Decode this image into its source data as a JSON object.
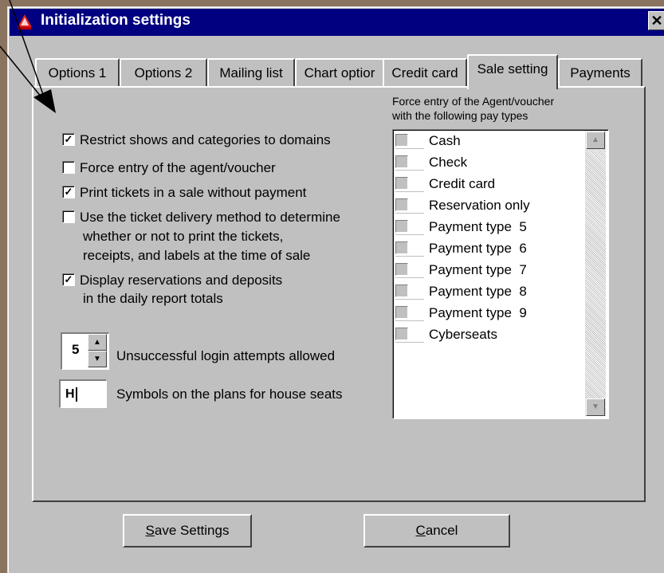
{
  "window": {
    "title": "Initialization settings",
    "close_symbol": "✕"
  },
  "tabs": [
    {
      "label": "Options 1",
      "active": false
    },
    {
      "label": "Options 2",
      "active": false
    },
    {
      "label": "Mailing list",
      "active": false
    },
    {
      "label": "Chart optior",
      "active": false
    },
    {
      "label": "Credit card",
      "active": false
    },
    {
      "label": "Sale setting",
      "active": true
    },
    {
      "label": "Payments",
      "active": false
    }
  ],
  "options": [
    {
      "lines": [
        "Restrict shows and categories to domains"
      ],
      "checked": true
    },
    {
      "lines": [
        "Force entry of the agent/voucher"
      ],
      "checked": false
    },
    {
      "lines": [
        "Print tickets in a sale without payment"
      ],
      "checked": true
    },
    {
      "lines": [
        "Use the ticket delivery method to determine",
        "whether or not to print the tickets,",
        "receipts, and labels at the time of sale"
      ],
      "checked": false
    },
    {
      "lines": [
        "Display reservations and deposits",
        "in the daily report totals"
      ],
      "checked": true
    }
  ],
  "login": {
    "value": "5",
    "label": "Unsuccessful login attempts allowed"
  },
  "house_seats": {
    "value": "H",
    "label": "Symbols on the plans for house seats"
  },
  "pay_types": {
    "header": [
      "Force entry of the Agent/voucher",
      "with the following pay types"
    ],
    "items": [
      "Cash",
      "Check",
      "Credit card",
      "Reservation only",
      "Payment type  5",
      "Payment type  6",
      "Payment type  7",
      "Payment type  8",
      "Payment type  9",
      "Cyberseats"
    ]
  },
  "buttons": {
    "save": {
      "mnemonic": "S",
      "rest": "ave Settings"
    },
    "cancel": {
      "mnemonic": "C",
      "rest": "ancel"
    }
  },
  "icons": {
    "window_icon": "shows-app-icon",
    "pointer": "annotation-arrow"
  },
  "colors": {
    "titlebar": "#000080",
    "face": "#c0c0c0"
  }
}
